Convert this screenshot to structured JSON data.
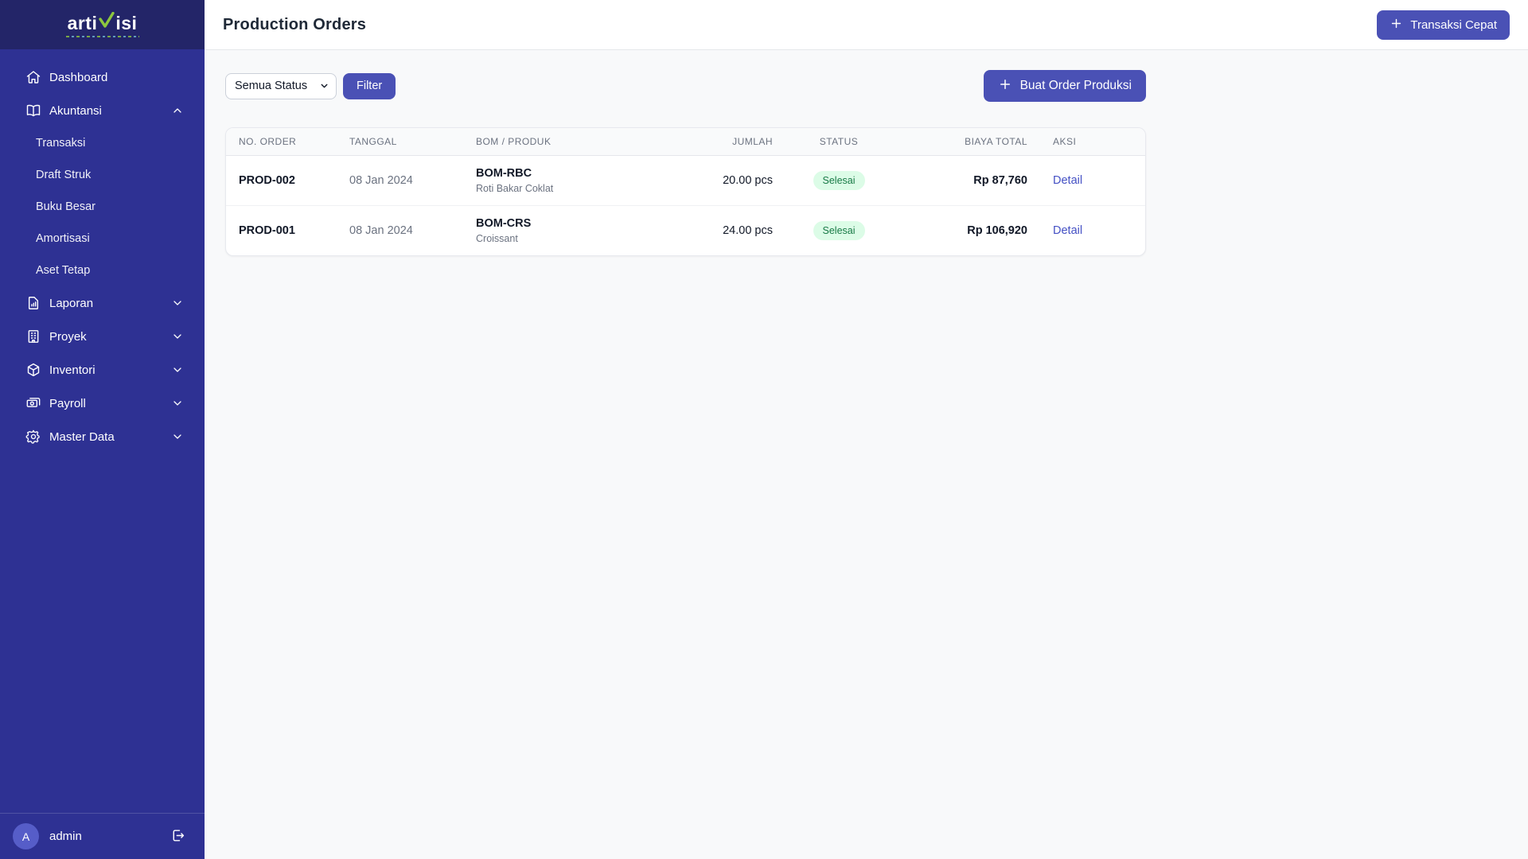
{
  "colors": {
    "sidebar_bg": "#2e3193",
    "sidebar_header_bg": "#232568",
    "accent_indigo": "#4a51b5",
    "logo_accent_green": "#8cc63f",
    "badge_bg": "#dcfce7",
    "badge_text": "#187a46",
    "link": "#4450c4",
    "page_bg": "#f8f9fa"
  },
  "sidebar": {
    "logo": {
      "part1": "arti",
      "accent_letter": "v",
      "part2": "isi"
    },
    "items": [
      {
        "label": "Dashboard",
        "icon": "home",
        "chevron": null
      },
      {
        "label": "Akuntansi",
        "icon": "book-open",
        "chevron": "up",
        "children": [
          "Transaksi",
          "Draft Struk",
          "Buku Besar",
          "Amortisasi",
          "Aset Tetap"
        ]
      },
      {
        "label": "Laporan",
        "icon": "document-chart",
        "chevron": "down"
      },
      {
        "label": "Proyek",
        "icon": "building",
        "chevron": "down"
      },
      {
        "label": "Inventori",
        "icon": "cube",
        "chevron": "down"
      },
      {
        "label": "Payroll",
        "icon": "banknotes",
        "chevron": "down"
      },
      {
        "label": "Master Data",
        "icon": "gear",
        "chevron": "down"
      }
    ],
    "user": {
      "initial": "A",
      "name": "admin"
    }
  },
  "header": {
    "title": "Production Orders",
    "quick_button_label": "Transaksi Cepat"
  },
  "toolbar": {
    "status_filter_value": "Semua Status",
    "filter_button_label": "Filter",
    "create_button_label": "Buat Order Produksi"
  },
  "table": {
    "columns": [
      "NO. ORDER",
      "TANGGAL",
      "BOM / PRODUK",
      "JUMLAH",
      "STATUS",
      "BIAYA TOTAL",
      "AKSI"
    ],
    "rows": [
      {
        "no_order": "PROD-002",
        "tanggal": "08 Jan 2024",
        "bom": "BOM-RBC",
        "produk": "Roti Bakar Coklat",
        "jumlah": "20.00 pcs",
        "status": "Selesai",
        "biaya": "Rp 87,760",
        "aksi": "Detail"
      },
      {
        "no_order": "PROD-001",
        "tanggal": "08 Jan 2024",
        "bom": "BOM-CRS",
        "produk": "Croissant",
        "jumlah": "24.00 pcs",
        "status": "Selesai",
        "biaya": "Rp 106,920",
        "aksi": "Detail"
      }
    ]
  }
}
